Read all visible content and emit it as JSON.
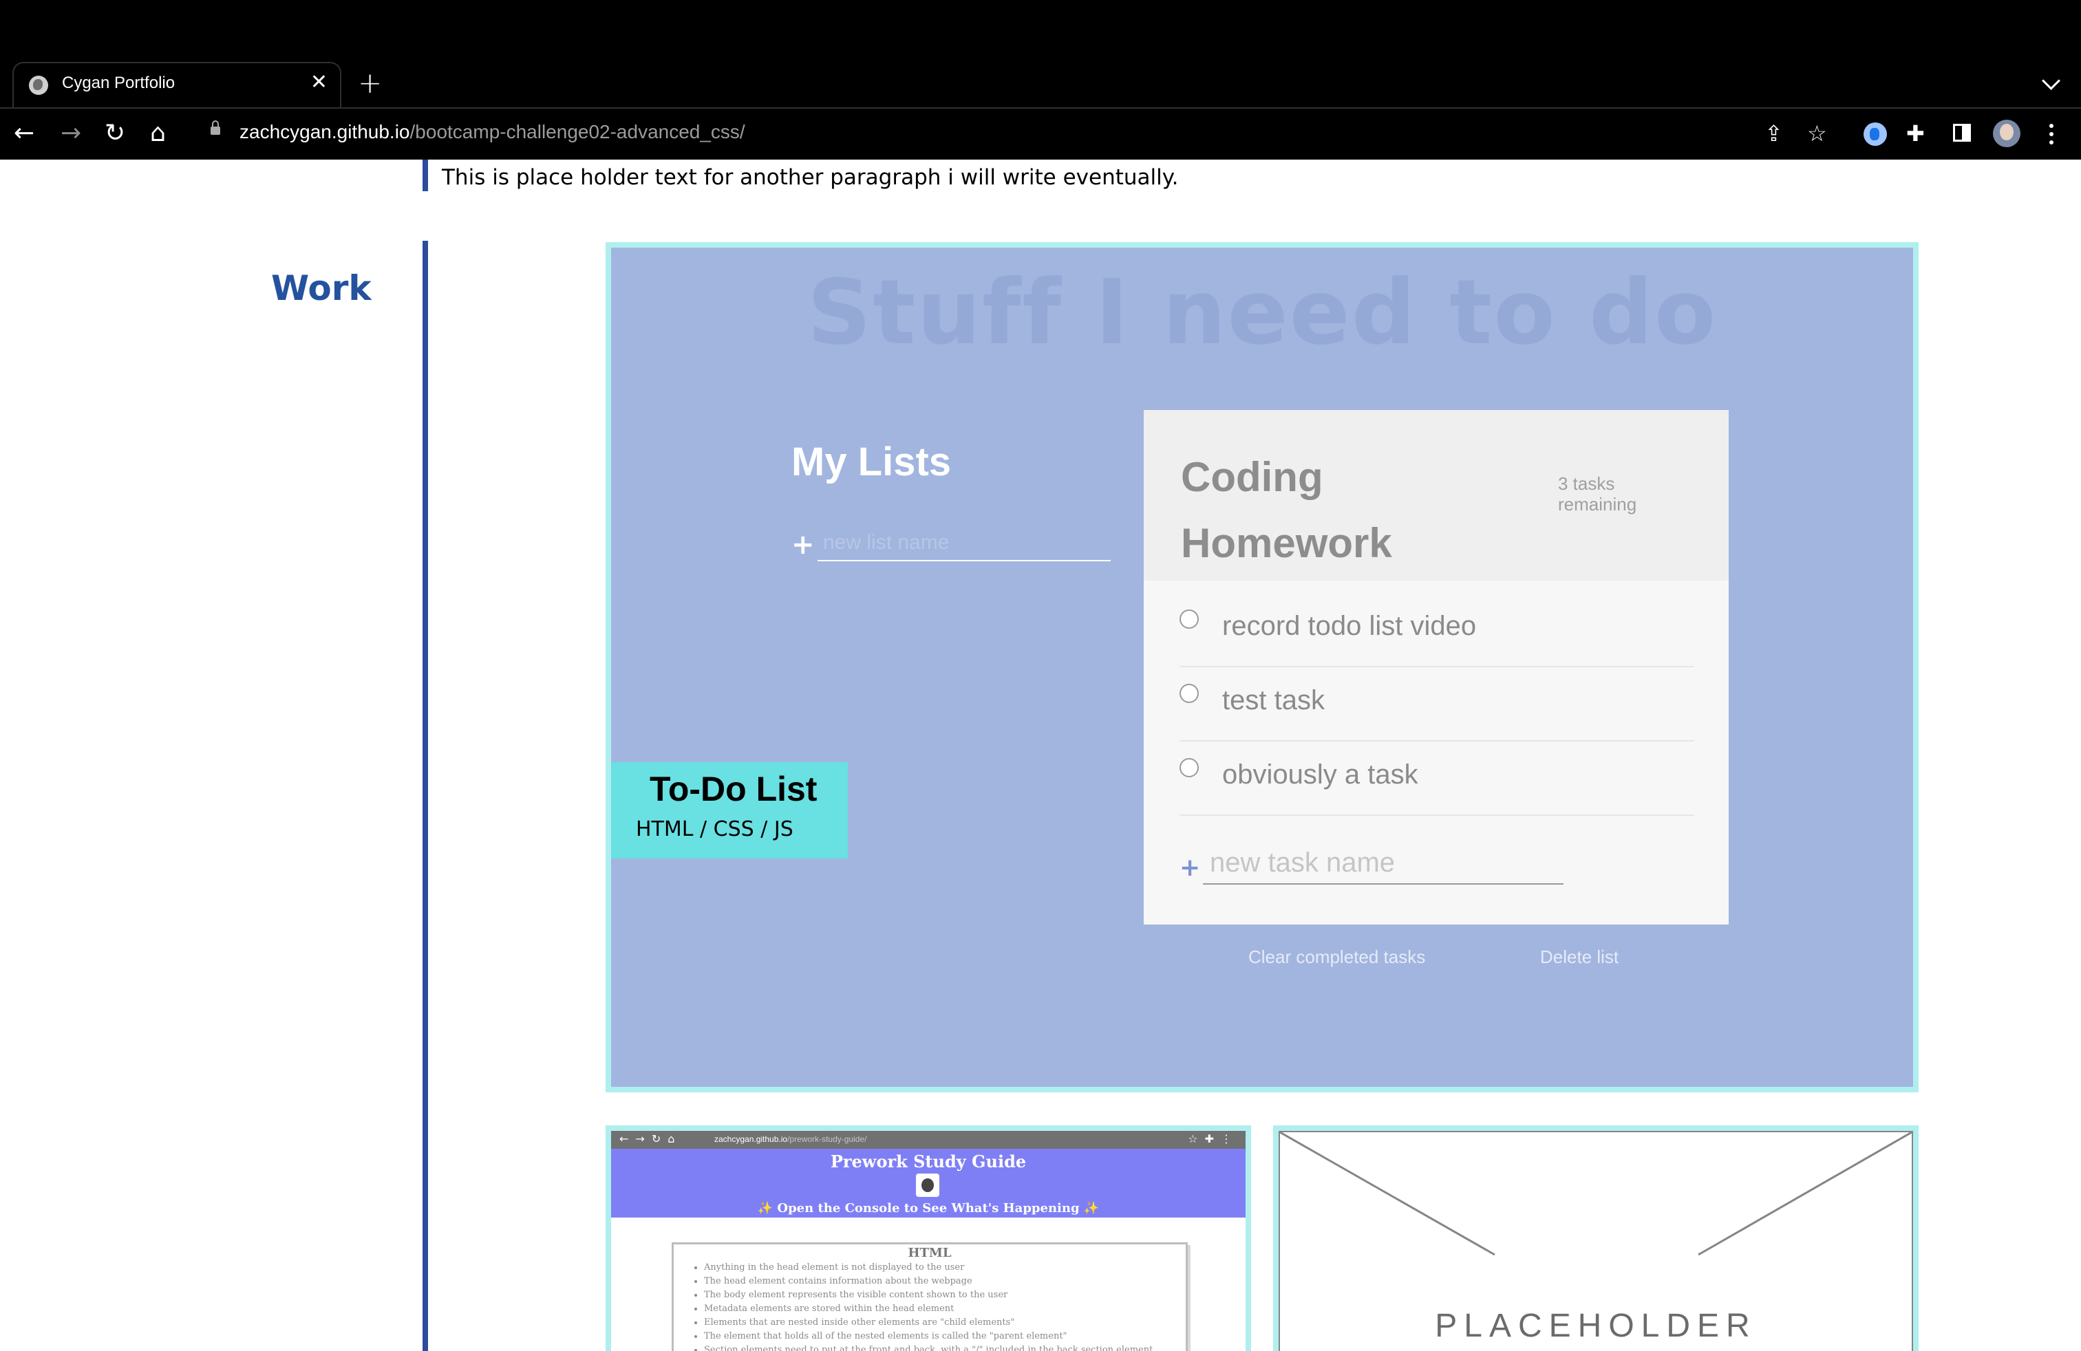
{
  "browser": {
    "tab": {
      "title": "Cygan Portfolio",
      "close": "✕"
    },
    "new_tab": "+",
    "url_host": "zachcygan.github.io",
    "url_path": "/bootcamp-challenge02-advanced_css/",
    "nav": {
      "back": "←",
      "forward": "→",
      "reload": "↻",
      "home": "⌂"
    },
    "actions": {
      "share": "⇪",
      "bookmark": "☆",
      "extensions": "✚"
    }
  },
  "page": {
    "about_paragraph": "This is place holder text for another paragraph i will write eventually.",
    "work_heading": "Work",
    "featured": {
      "app_title": "Stuff I need to do",
      "my_lists_heading": "My Lists",
      "new_list_plus": "+",
      "new_list_placeholder": "new list name",
      "list_title": "Coding Homework",
      "tasks_remaining": "3 tasks remaining",
      "tasks": [
        {
          "label": "record todo list video"
        },
        {
          "label": "test task"
        },
        {
          "label": "obviously a task"
        }
      ],
      "new_task_plus": "+",
      "new_task_placeholder": "new task name",
      "clear_completed": "Clear completed tasks",
      "delete_list": "Delete list",
      "project_name": "To-Do List",
      "project_tech": "HTML / CSS / JS"
    },
    "thumb_prework": {
      "url_host": "zachcygan.github.io",
      "url_path": "/prework-study-guide/",
      "title": "Prework Study Guide",
      "console_note": "✨ Open the Console to See What's Happening ✨",
      "section_title": "HTML",
      "items": [
        "Anything in the head element is not displayed to the user",
        "The head element contains information about the webpage",
        "The body element represents the visible content shown to the user",
        "Metadata elements are stored within the head element",
        "Elements that are nested inside other elements are \"child elements\"",
        "The element that holds all of the nested elements is called the \"parent element\"",
        "Section elements need to put at the front and back, with a \"/\" included in the back section element"
      ]
    },
    "thumb_placeholder": {
      "label": "PLACEHOLDER"
    }
  },
  "colors": {
    "accent_blue": "#2c4d9e",
    "work_heading": "#24529e",
    "feature_bg": "#a2b5df",
    "feature_border": "#b0efef",
    "project_label_bg": "#69e0e2",
    "mini_header": "#7f7ff5"
  }
}
